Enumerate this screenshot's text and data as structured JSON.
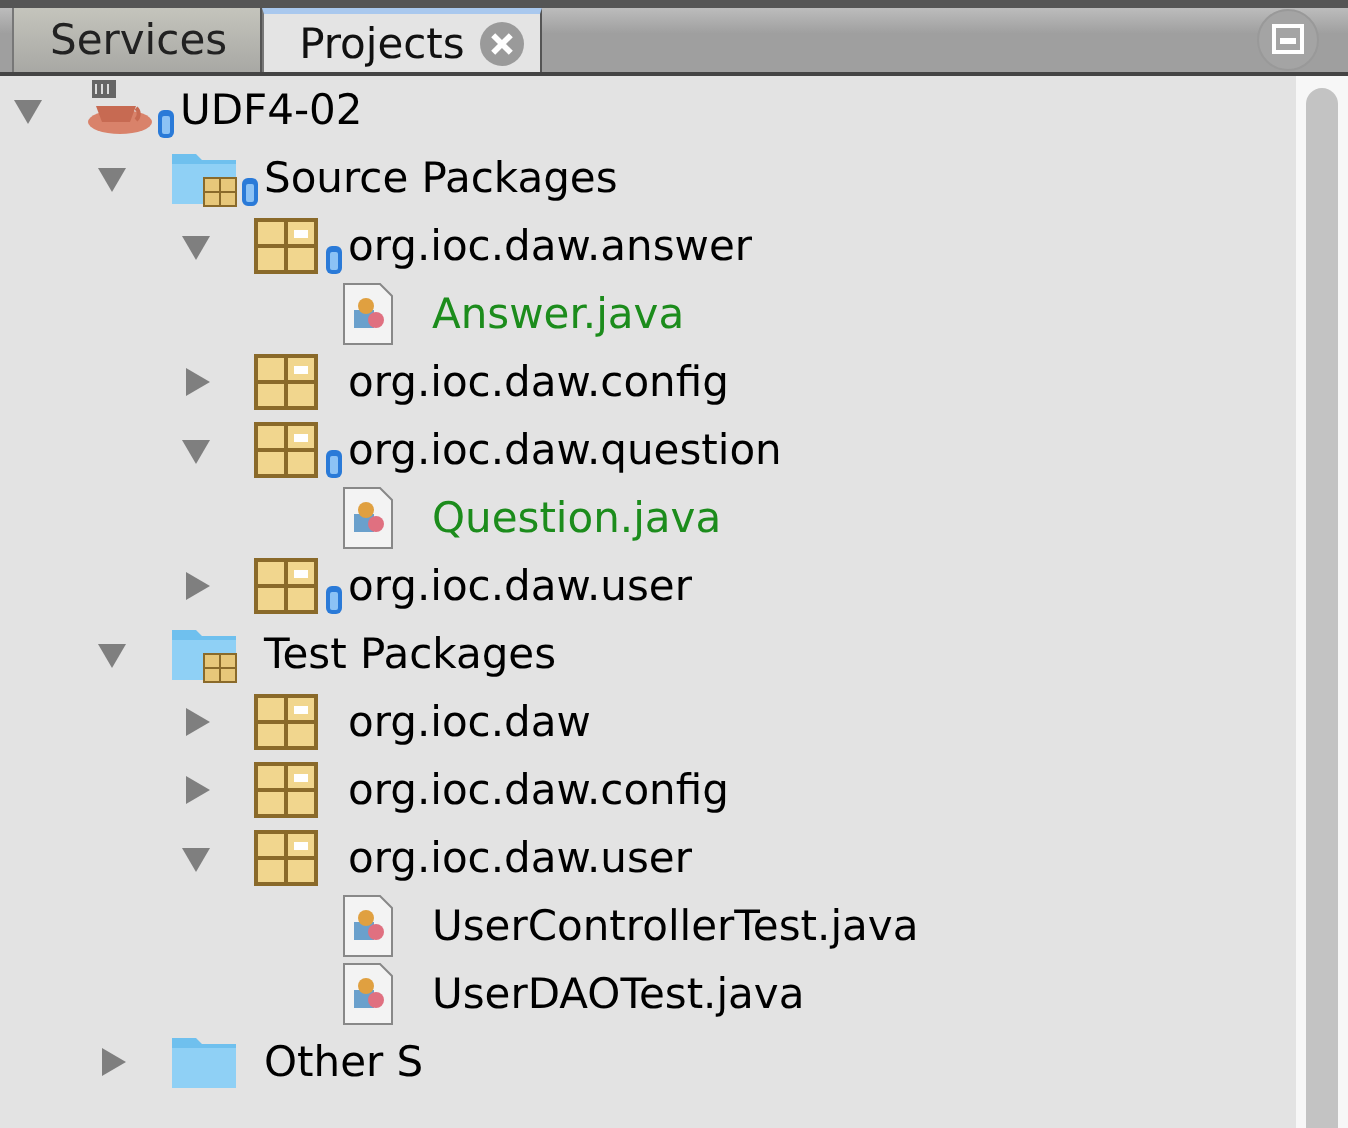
{
  "tabs": [
    {
      "label": "Services",
      "selected": false,
      "closable": false
    },
    {
      "label": "Projects",
      "selected": true,
      "closable": true
    }
  ],
  "tree": [
    {
      "kind": "project",
      "label": "UDF4-02",
      "badge": true,
      "color": "#000000",
      "expanded": true,
      "children": [
        {
          "kind": "source-root",
          "label": "Source Packages",
          "badge": true,
          "color": "#000000",
          "expanded": true,
          "children": [
            {
              "kind": "package",
              "label": "org.ioc.daw.answer",
              "badge": true,
              "color": "#000000",
              "expanded": true,
              "children": [
                {
                  "kind": "java",
                  "label": "Answer.java",
                  "badge": false,
                  "color": "#1c8c1c"
                }
              ]
            },
            {
              "kind": "package",
              "label": "org.ioc.daw.config",
              "badge": false,
              "color": "#000000",
              "expanded": false
            },
            {
              "kind": "package",
              "label": "org.ioc.daw.question",
              "badge": true,
              "color": "#000000",
              "expanded": true,
              "children": [
                {
                  "kind": "java",
                  "label": "Question.java",
                  "badge": false,
                  "color": "#1c8c1c"
                }
              ]
            },
            {
              "kind": "package",
              "label": "org.ioc.daw.user",
              "badge": true,
              "color": "#000000",
              "expanded": false
            }
          ]
        },
        {
          "kind": "test-root",
          "label": "Test Packages",
          "badge": false,
          "color": "#000000",
          "expanded": true,
          "children": [
            {
              "kind": "package",
              "label": "org.ioc.daw",
              "badge": false,
              "color": "#000000",
              "expanded": false
            },
            {
              "kind": "package",
              "label": "org.ioc.daw.config",
              "badge": false,
              "color": "#000000",
              "expanded": false
            },
            {
              "kind": "package",
              "label": "org.ioc.daw.user",
              "badge": false,
              "color": "#000000",
              "expanded": true,
              "children": [
                {
                  "kind": "java",
                  "label": "UserControllerTest.java",
                  "badge": false,
                  "color": "#000000"
                },
                {
                  "kind": "java",
                  "label": "UserDAOTest.java",
                  "badge": false,
                  "color": "#000000"
                }
              ]
            }
          ]
        },
        {
          "kind": "folder",
          "label": "Other S",
          "badge": false,
          "color": "#000000",
          "expanded": false
        }
      ]
    }
  ]
}
